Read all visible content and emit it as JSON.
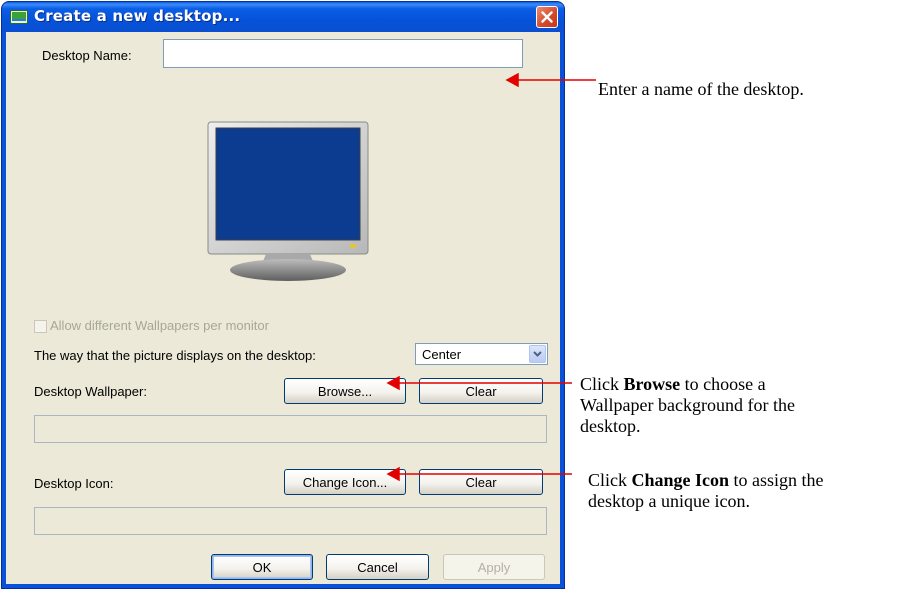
{
  "window": {
    "title": "Create a new desktop...",
    "colors": {
      "titlebar": "#0553d9",
      "client": "#ece9d8",
      "close": "#d4472a"
    }
  },
  "form": {
    "desktop_name_label": "Desktop Name:",
    "desktop_name_value": "",
    "allow_wallpapers_label": "Allow different Wallpapers per monitor",
    "allow_wallpapers_checked": false,
    "display_mode_label": "The way that the picture displays on the desktop:",
    "display_mode_value": "Center",
    "wallpaper_label": "Desktop Wallpaper:",
    "wallpaper_browse": "Browse...",
    "wallpaper_clear": "Clear",
    "wallpaper_path": "",
    "icon_label": "Desktop Icon:",
    "icon_change": "Change Icon...",
    "icon_clear": "Clear",
    "icon_path": ""
  },
  "footer": {
    "ok": "OK",
    "cancel": "Cancel",
    "apply": "Apply"
  },
  "monitor": {
    "screen_color": "#0b3c8f"
  },
  "annotations": {
    "name": "Enter a name of the desktop.",
    "browse_pre": "Click ",
    "browse_bold": "Browse",
    "browse_post": " to choose a",
    "browse_line2": "Wallpaper background for the",
    "browse_line3": "desktop.",
    "icon_pre": "Click ",
    "icon_bold": "Change Icon",
    "icon_post": " to assign the",
    "icon_line2": "desktop a unique icon.",
    "arrow_color": "#e30000"
  }
}
